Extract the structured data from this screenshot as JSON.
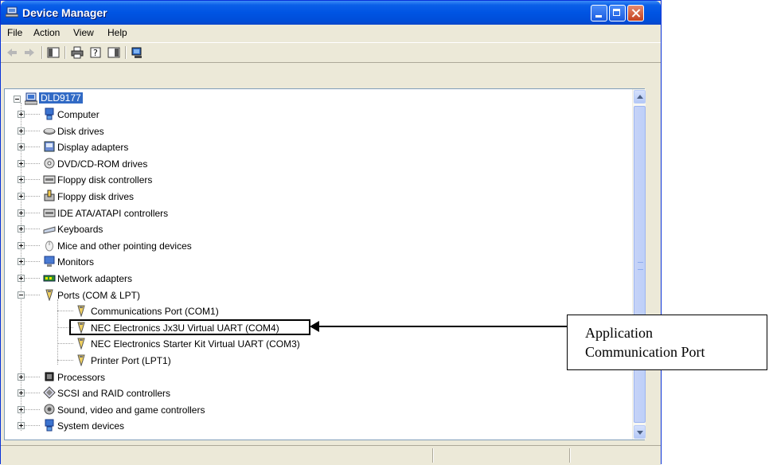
{
  "window": {
    "title": "Device Manager"
  },
  "menu": [
    {
      "label": "File"
    },
    {
      "label": "Action"
    },
    {
      "label": "View"
    },
    {
      "label": "Help"
    }
  ],
  "tree": {
    "root": "DLD9177",
    "categories": [
      {
        "label": "Computer",
        "icon": "computer-icon"
      },
      {
        "label": "Disk drives",
        "icon": "disk-drive-icon"
      },
      {
        "label": "Display adapters",
        "icon": "display-adapter-icon"
      },
      {
        "label": "DVD/CD-ROM drives",
        "icon": "dvd-drive-icon"
      },
      {
        "label": "Floppy disk controllers",
        "icon": "controller-icon"
      },
      {
        "label": "Floppy disk drives",
        "icon": "floppy-drive-icon"
      },
      {
        "label": "IDE ATA/ATAPI controllers",
        "icon": "controller-icon"
      },
      {
        "label": "Keyboards",
        "icon": "keyboard-icon"
      },
      {
        "label": "Mice and other pointing devices",
        "icon": "mouse-icon"
      },
      {
        "label": "Monitors",
        "icon": "monitor-icon"
      },
      {
        "label": "Network adapters",
        "icon": "network-adapter-icon"
      },
      {
        "label": "Ports (COM & LPT)",
        "icon": "port-icon"
      }
    ],
    "ports_children": [
      {
        "label": "Communications Port (COM1)"
      },
      {
        "label": "NEC Electronics Jx3U Virtual UART (COM4)"
      },
      {
        "label": "NEC Electronics Starter Kit Virtual UART (COM3)"
      },
      {
        "label": "Printer Port (LPT1)"
      }
    ],
    "after": [
      {
        "label": "Processors",
        "icon": "processor-icon"
      },
      {
        "label": "SCSI and RAID controllers",
        "icon": "scsi-icon"
      },
      {
        "label": "Sound, video and game controllers",
        "icon": "sound-icon"
      },
      {
        "label": "System devices",
        "icon": "system-icon"
      }
    ]
  },
  "callout": {
    "line1": "Application",
    "line2": "Communication Port"
  }
}
